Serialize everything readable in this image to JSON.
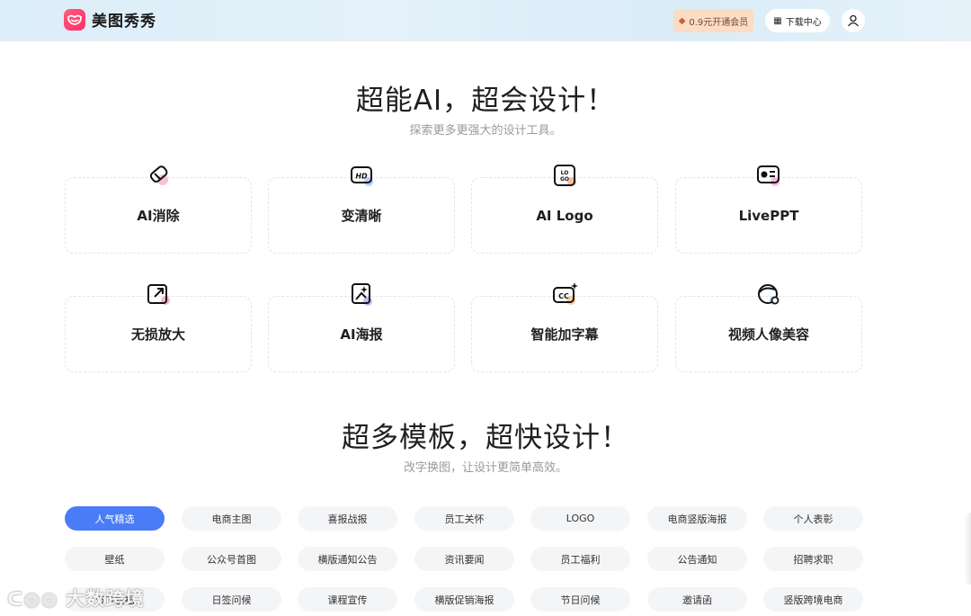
{
  "header": {
    "brand": "美图秀秀",
    "vip_label": "0.9元开通会员",
    "download_label": "下载中心"
  },
  "ai_section": {
    "title": "超能AI，超会设计！",
    "subtitle": "探索更多更强大的设计工具。",
    "tools": [
      {
        "label": "AI消除",
        "icon": "eraser-icon"
      },
      {
        "label": "变清晰",
        "icon": "hd-icon"
      },
      {
        "label": "AI Logo",
        "icon": "logo-icon"
      },
      {
        "label": "LivePPT",
        "icon": "ppt-icon"
      },
      {
        "label": "无损放大",
        "icon": "enlarge-icon"
      },
      {
        "label": "AI海报",
        "icon": "poster-icon"
      },
      {
        "label": "智能加字幕",
        "icon": "caption-icon"
      },
      {
        "label": "视频人像美容",
        "icon": "face-beauty-icon"
      }
    ]
  },
  "template_section": {
    "title": "超多模板，超快设计！",
    "subtitle": "改字换图，让设计更简单高效。",
    "chips": [
      "人气精选",
      "电商主图",
      "喜报战报",
      "员工关怀",
      "LOGO",
      "电商竖版海报",
      "个人表彰",
      "壁纸",
      "公众号首图",
      "横版通知公告",
      "资讯要闻",
      "员工福利",
      "公告通知",
      "招聘求职",
      "节日祝福",
      "日签问候",
      "课程宣传",
      "横版促销海报",
      "节日问候",
      "邀请函",
      "竖版跨境电商"
    ],
    "active_index": 0
  },
  "watermark": "大数跨境",
  "colors": {
    "accent": "#4a7cf7",
    "brand": "#ff2f6a",
    "vip_bg": "#fbdcc4"
  }
}
